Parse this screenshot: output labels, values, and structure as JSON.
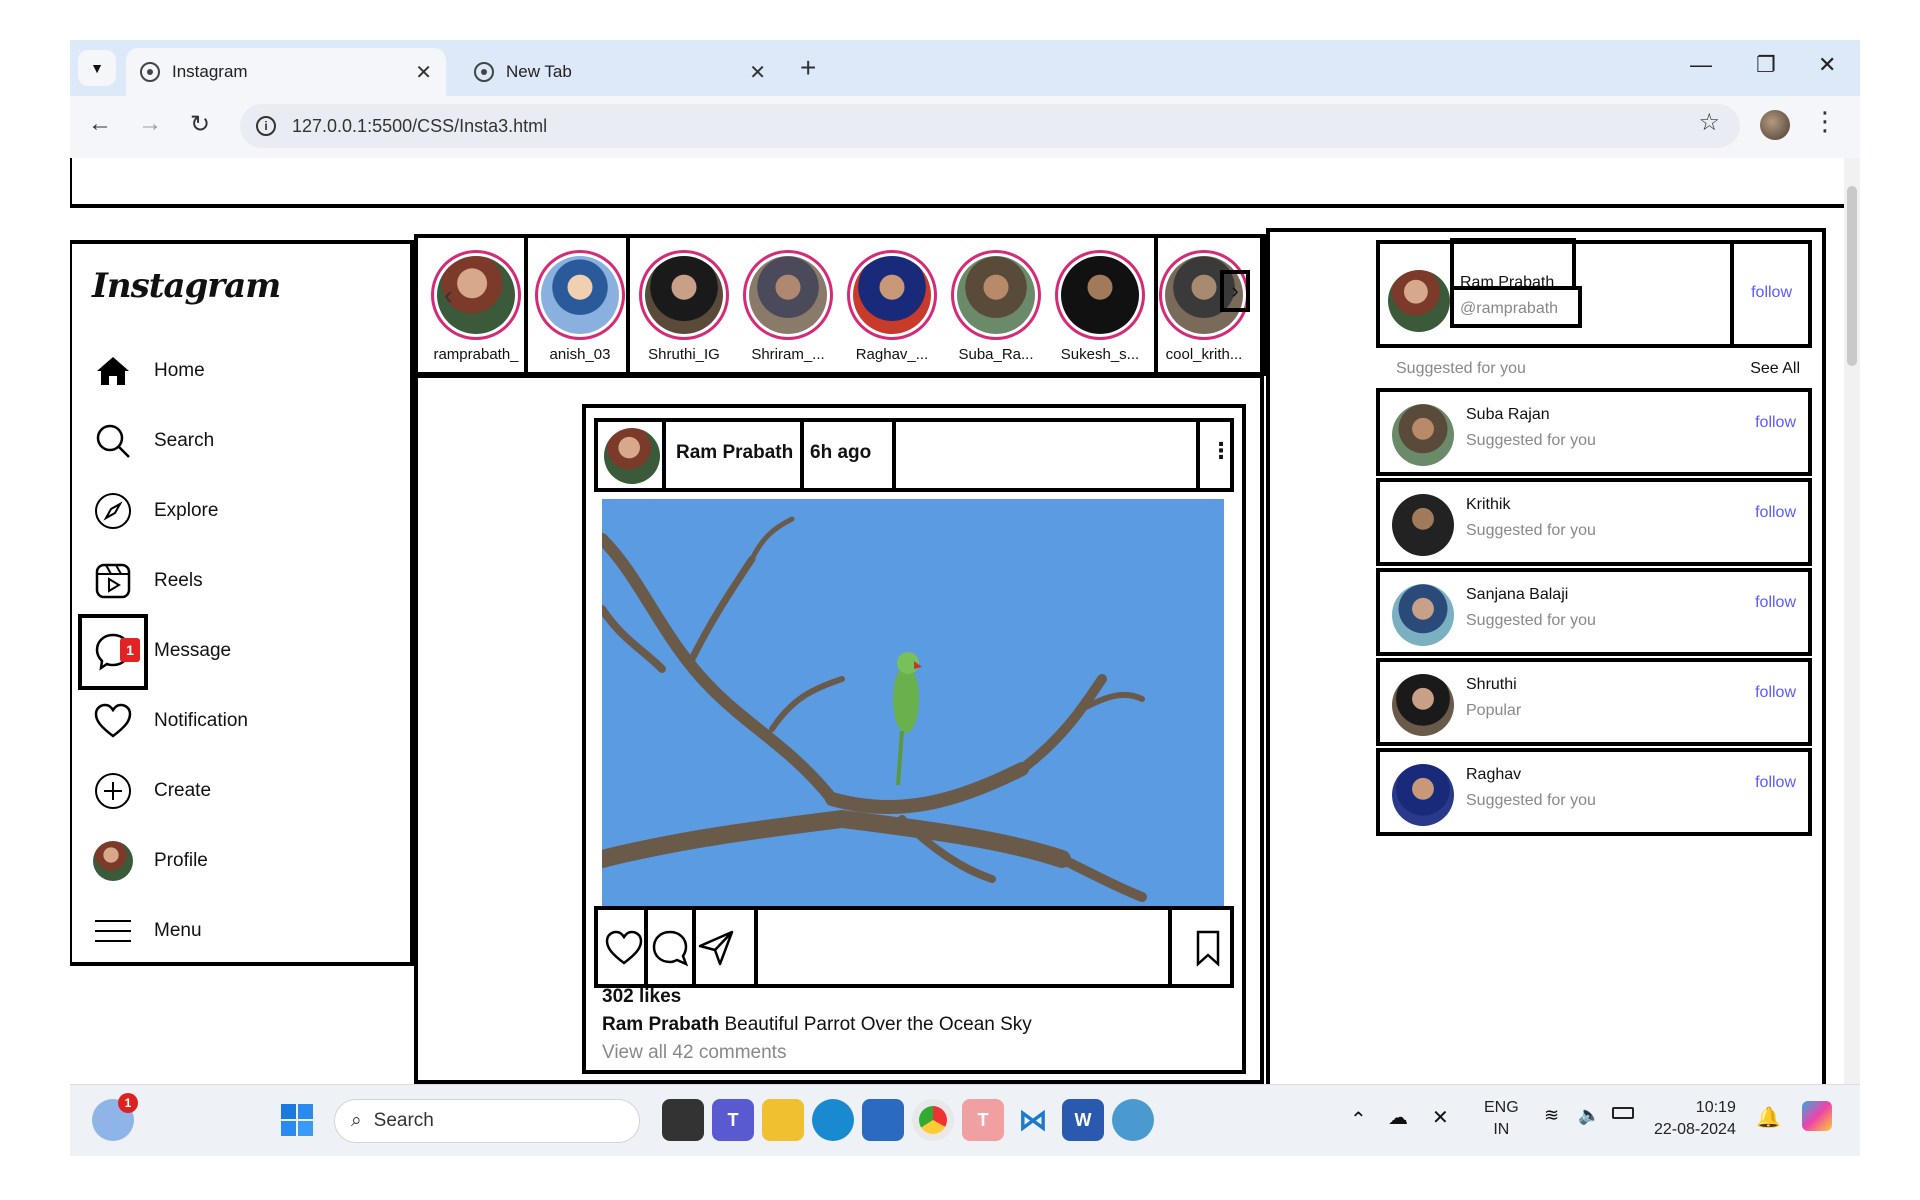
{
  "browser": {
    "tabs": [
      {
        "title": "Instagram"
      },
      {
        "title": "New Tab"
      }
    ],
    "url": "127.0.0.1:5500/CSS/Insta3.html"
  },
  "sidebar": {
    "logo": "Instagram",
    "items": [
      {
        "label": "Home",
        "icon": "home-icon"
      },
      {
        "label": "Search",
        "icon": "search-icon"
      },
      {
        "label": "Explore",
        "icon": "compass-icon"
      },
      {
        "label": "Reels",
        "icon": "reels-icon"
      },
      {
        "label": "Message",
        "icon": "message-icon",
        "badge": "1"
      },
      {
        "label": "Notification",
        "icon": "heart-icon"
      },
      {
        "label": "Create",
        "icon": "plus-circle-icon"
      },
      {
        "label": "Profile",
        "icon": "avatar"
      },
      {
        "label": "Menu",
        "icon": "hamburger-icon"
      }
    ]
  },
  "stories": [
    "ramprabath_",
    "anish_03",
    "Shruthi_IG",
    "Shriram_...",
    "Raghav_...",
    "Suba_Ra...",
    "Sukesh_s...",
    "cool_krith..."
  ],
  "post": {
    "username": "Ram Prabath",
    "time": "6h ago",
    "likes": "302 likes",
    "caption_user": "Ram Prabath",
    "caption_text": " Beautiful Parrot Over the Ocean Sky",
    "comments_link": "View all 42 comments"
  },
  "right": {
    "me": {
      "name": "Ram Prabath",
      "handle": "@ramprabath",
      "action": "follow"
    },
    "suggested_header": "Suggested for you",
    "see_all": "See All",
    "suggestions": [
      {
        "name": "Suba Rajan",
        "sub": "Suggested for you",
        "action": "follow"
      },
      {
        "name": "Krithik",
        "sub": "Suggested for you",
        "action": "follow"
      },
      {
        "name": "Sanjana Balaji",
        "sub": "Suggested for you",
        "action": "follow"
      },
      {
        "name": "Shruthi",
        "sub": "Popular",
        "action": "follow"
      },
      {
        "name": "Raghav",
        "sub": "Suggested for you",
        "action": "follow"
      }
    ]
  },
  "taskbar": {
    "search_placeholder": "Search",
    "weather_badge": "1",
    "lang_top": "ENG",
    "lang_bottom": "IN",
    "time": "10:19",
    "date": "22-08-2024"
  }
}
